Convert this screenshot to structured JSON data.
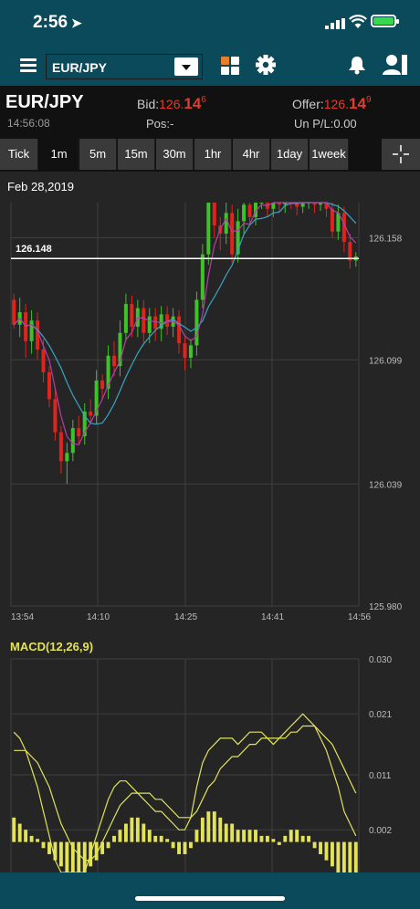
{
  "status": {
    "time": "2:56",
    "location_icon": "location-arrow-icon"
  },
  "nav": {
    "pair": "EUR/JPY",
    "icons": [
      "menu-icon",
      "grid-icon",
      "gear-icon",
      "bell-icon",
      "account-icon"
    ],
    "grid_colors": [
      "#e8802a",
      "#ffffff",
      "#ffffff",
      "#ffffff"
    ]
  },
  "quote": {
    "pair": "EUR/JPY",
    "time": "14:56:08",
    "bid_label": "Bid:",
    "bid_prefix": "126.",
    "bid_big": "14",
    "bid_sup": "6",
    "offer_label": "Offer:",
    "offer_prefix": "126.",
    "offer_big": "14",
    "offer_sup": "9",
    "pos_label": "Pos:",
    "pos_value": "-",
    "upl_label": "Un P/L:",
    "upl_value": "0.00"
  },
  "timeframes": [
    {
      "label": "Tick",
      "active": false
    },
    {
      "label": "1m",
      "active": true
    },
    {
      "label": "5m",
      "active": false
    },
    {
      "label": "15m",
      "active": false
    },
    {
      "label": "30m",
      "active": false
    },
    {
      "label": "1hr",
      "active": false
    },
    {
      "label": "4hr",
      "active": false
    },
    {
      "label": "1day",
      "active": false
    },
    {
      "label": "1week",
      "active": false
    }
  ],
  "colors": {
    "up": "#3fc12a",
    "down": "#e0241b",
    "ma_blue": "#3aa5c0",
    "ma_purple": "#b43ea8",
    "macd": "#e3e35a",
    "grid": "#3e3e3e"
  },
  "chart_data": [
    {
      "type": "candlestick",
      "date_label": "Feb 28,2019",
      "current_price_label": "126.148",
      "current_price": 126.148,
      "ylim": [
        125.98,
        126.175
      ],
      "y_ticks": [
        "126.158",
        "126.099",
        "126.039",
        "125.980"
      ],
      "x_ticks": [
        "13:54",
        "14:10",
        "14:25",
        "14:41",
        "14:56"
      ],
      "candles": [
        [
          126.128,
          126.116,
          126.114,
          126.131
        ],
        [
          126.116,
          126.122,
          126.11,
          126.129
        ],
        [
          126.122,
          126.108,
          126.1,
          126.126
        ],
        [
          126.108,
          126.118,
          126.102,
          126.123
        ],
        [
          126.118,
          126.104,
          126.099,
          126.122
        ],
        [
          126.104,
          126.093,
          126.088,
          126.109
        ],
        [
          126.093,
          126.08,
          126.076,
          126.096
        ],
        [
          126.08,
          126.064,
          126.06,
          126.085
        ],
        [
          126.064,
          126.05,
          126.044,
          126.067
        ],
        [
          126.05,
          126.054,
          126.039,
          126.059
        ],
        [
          126.054,
          126.066,
          126.05,
          126.07
        ],
        [
          126.066,
          126.062,
          126.058,
          126.072
        ],
        [
          126.062,
          126.074,
          126.058,
          126.078
        ],
        [
          126.074,
          126.072,
          126.068,
          126.08
        ],
        [
          126.072,
          126.089,
          126.068,
          126.094
        ],
        [
          126.089,
          126.085,
          126.08,
          126.092
        ],
        [
          126.085,
          126.101,
          126.08,
          126.106
        ],
        [
          126.101,
          126.096,
          126.091,
          126.108
        ],
        [
          126.096,
          126.112,
          126.091,
          126.118
        ],
        [
          126.112,
          126.126,
          126.108,
          126.131
        ],
        [
          126.126,
          126.115,
          126.11,
          126.13
        ],
        [
          126.115,
          126.124,
          126.11,
          126.128
        ],
        [
          126.124,
          126.112,
          126.107,
          126.128
        ],
        [
          126.112,
          126.12,
          126.107,
          126.124
        ],
        [
          126.12,
          126.114,
          126.108,
          126.124
        ],
        [
          126.114,
          126.121,
          126.108,
          126.125
        ],
        [
          126.121,
          126.115,
          126.111,
          126.125
        ],
        [
          126.115,
          126.12,
          126.11,
          126.124
        ],
        [
          126.12,
          126.107,
          126.102,
          126.123
        ],
        [
          126.107,
          126.1,
          126.094,
          126.11
        ],
        [
          126.1,
          126.106,
          126.095,
          126.109
        ],
        [
          126.106,
          126.128,
          126.101,
          126.132
        ],
        [
          126.128,
          126.15,
          126.124,
          126.155
        ],
        [
          126.15,
          126.175,
          126.145,
          126.18
        ],
        [
          126.175,
          126.164,
          126.158,
          126.178
        ],
        [
          126.164,
          126.16,
          126.152,
          126.168
        ],
        [
          126.16,
          126.17,
          126.155,
          126.175
        ],
        [
          126.17,
          126.15,
          126.146,
          126.174
        ],
        [
          126.15,
          126.166,
          126.146,
          126.172
        ],
        [
          126.166,
          126.174,
          126.16,
          126.18
        ],
        [
          126.174,
          126.168,
          126.164,
          126.178
        ],
        [
          126.168,
          126.176,
          126.164,
          126.18
        ],
        [
          126.176,
          126.178,
          126.172,
          126.182
        ],
        [
          126.178,
          126.172,
          126.168,
          126.182
        ],
        [
          126.172,
          126.176,
          126.168,
          126.18
        ],
        [
          126.176,
          126.174,
          126.17,
          126.18
        ],
        [
          126.174,
          126.178,
          126.17,
          126.181
        ],
        [
          126.178,
          126.176,
          126.172,
          126.181
        ],
        [
          126.176,
          126.173,
          126.169,
          126.179
        ],
        [
          126.173,
          126.177,
          126.17,
          126.181
        ],
        [
          126.177,
          126.178,
          126.172,
          126.181
        ],
        [
          126.178,
          126.174,
          126.17,
          126.181
        ],
        [
          126.174,
          126.178,
          126.171,
          126.181
        ],
        [
          126.178,
          126.172,
          126.168,
          126.181
        ],
        [
          126.172,
          126.161,
          126.158,
          126.176
        ],
        [
          126.161,
          126.17,
          126.157,
          126.174
        ],
        [
          126.17,
          126.156,
          126.151,
          126.173
        ],
        [
          126.156,
          126.147,
          126.143,
          126.16
        ],
        [
          126.147,
          126.149,
          126.144,
          126.151
        ]
      ]
    },
    {
      "type": "macd",
      "title": "MACD(12,26,9)",
      "ylim": [
        -0.005,
        0.03
      ],
      "y_ticks": [
        "0.030",
        "0.021",
        "0.011",
        "0.002"
      ],
      "macd": [
        0.018,
        0.017,
        0.015,
        0.012,
        0.009,
        0.005,
        0.001,
        -0.003,
        -0.006,
        -0.008,
        -0.008,
        -0.007,
        -0.005,
        -0.002,
        0.001,
        0.004,
        0.007,
        0.009,
        0.01,
        0.01,
        0.009,
        0.008,
        0.007,
        0.006,
        0.005,
        0.005,
        0.004,
        0.003,
        0.002,
        0.002,
        0.004,
        0.009,
        0.013,
        0.015,
        0.016,
        0.017,
        0.017,
        0.017,
        0.016,
        0.017,
        0.018,
        0.018,
        0.018,
        0.017,
        0.016,
        0.017,
        0.018,
        0.019,
        0.02,
        0.021,
        0.02,
        0.019,
        0.017,
        0.015,
        0.012,
        0.009,
        0.005,
        0.003,
        0.001
      ],
      "signal": [
        0.015,
        0.015,
        0.015,
        0.014,
        0.013,
        0.011,
        0.009,
        0.006,
        0.003,
        0.001,
        -0.001,
        -0.002,
        -0.003,
        -0.003,
        -0.002,
        0.0,
        0.002,
        0.004,
        0.006,
        0.007,
        0.008,
        0.008,
        0.008,
        0.008,
        0.007,
        0.007,
        0.006,
        0.005,
        0.004,
        0.004,
        0.004,
        0.005,
        0.007,
        0.009,
        0.01,
        0.012,
        0.013,
        0.014,
        0.014,
        0.015,
        0.016,
        0.016,
        0.017,
        0.017,
        0.017,
        0.017,
        0.017,
        0.018,
        0.018,
        0.019,
        0.019,
        0.019,
        0.018,
        0.017,
        0.016,
        0.014,
        0.012,
        0.01,
        0.008
      ],
      "histogram": [
        0.004,
        0.003,
        0.002,
        0.001,
        0.0005,
        -0.001,
        -0.002,
        -0.003,
        -0.004,
        -0.005,
        -0.005,
        -0.005,
        -0.005,
        -0.004,
        -0.003,
        -0.002,
        -0.001,
        0.001,
        0.002,
        0.003,
        0.004,
        0.004,
        0.003,
        0.002,
        0.001,
        0.001,
        0.0005,
        -0.001,
        -0.002,
        -0.002,
        -0.001,
        0.002,
        0.004,
        0.005,
        0.005,
        0.004,
        0.003,
        0.003,
        0.002,
        0.002,
        0.002,
        0.002,
        0.001,
        0.001,
        0.0005,
        -0.0005,
        0.001,
        0.002,
        0.002,
        0.001,
        0.001,
        -0.001,
        -0.002,
        -0.003,
        -0.004,
        -0.005,
        -0.006,
        -0.007,
        -0.007
      ]
    }
  ]
}
